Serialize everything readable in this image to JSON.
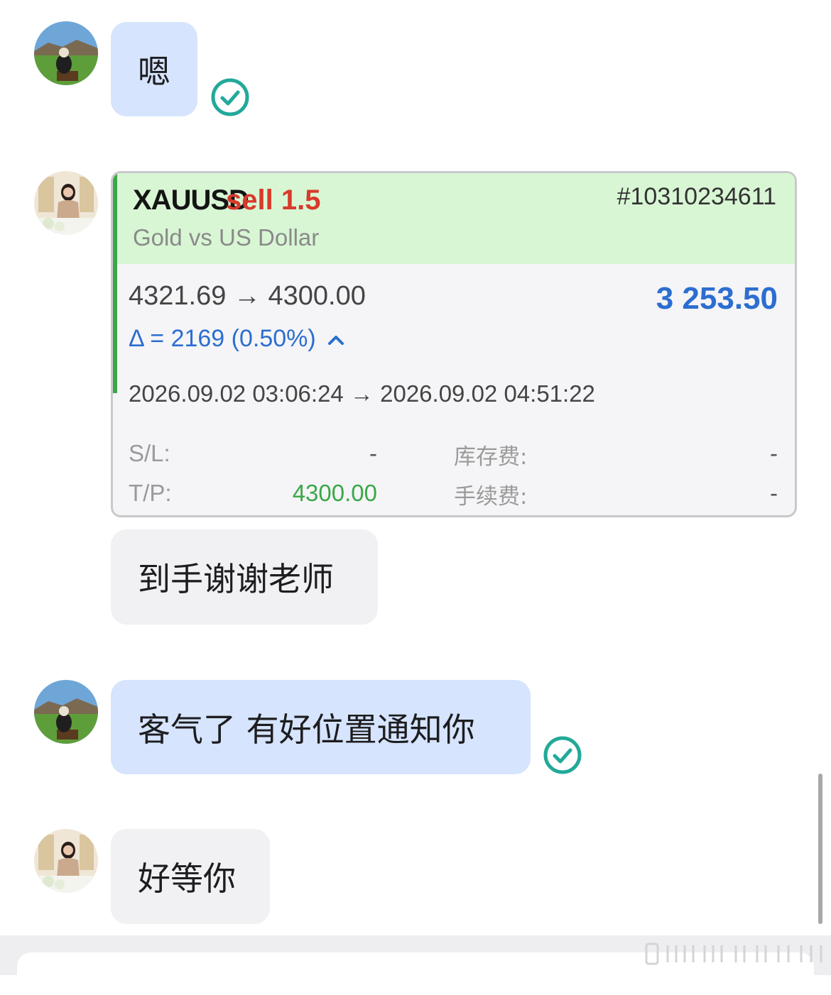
{
  "messages": [
    {
      "sender": "me",
      "text": "嗯",
      "status": "read"
    },
    {
      "sender": "other",
      "type": "trade-card"
    },
    {
      "sender": "other",
      "text": "到手谢谢老师"
    },
    {
      "sender": "me",
      "text": "客气了 有好位置通知你",
      "status": "read"
    },
    {
      "sender": "other",
      "text": "好等你"
    }
  ],
  "trade": {
    "symbol": "XAUUSD",
    "side": "sell 1.5",
    "ticket": "#10310234611",
    "description": "Gold vs US Dollar",
    "prices": "4321.69 → 4300.00",
    "profit": "3 253.50",
    "delta": "Δ = 2169 (0.50%)",
    "times": "2026.09.02 03:06:24 → 2026.09.02 04:51:22",
    "sl_label": "S/L:",
    "sl_value": "-",
    "tp_label": "T/P:",
    "tp_value": "4300.00",
    "swap_label": "库存费:",
    "swap_value": "-",
    "commission_label": "手续费:",
    "commission_value": "-"
  },
  "colors": {
    "my_bubble": "#d6e4fd",
    "other_bubble": "#f1f1f4",
    "read_check": "#22a99a",
    "card_header": "#d8f6d4",
    "sell": "#d93a2b",
    "profit_blue": "#2c6ed0",
    "tp_green": "#3aa748"
  },
  "icons": {
    "read_status": "check-circle-icon",
    "delta_direction": "chevron-up-icon"
  }
}
